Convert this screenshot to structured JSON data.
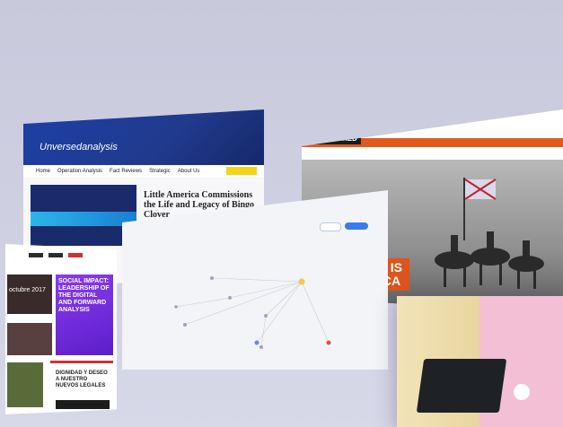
{
  "unversed": {
    "logo": "Unversedanalysis",
    "nav": [
      "Home",
      "Operation Analysis",
      "Fact Reviews",
      "Strategic",
      "About Us"
    ],
    "headline": "Little America Commissions the Life and Legacy of Bingo Clover"
  },
  "magazine": {
    "purple_headline": "SOCIAL IMPACT: LEADERSHIP OF THE DIGITAL AND FORWARD ANALYSIS",
    "red_headline": "DIGNIDAD Y DESEO A NUESTRO NUEVOS LEGALES",
    "date_fragment": "octubre 2017"
  },
  "news": {
    "brand": "UNLEASHED",
    "caption_line1": "IAL BORDER IS",
    "caption_line2": "LOT IN AFRICA"
  },
  "graph": {
    "btn_a": "",
    "btn_b": ""
  }
}
